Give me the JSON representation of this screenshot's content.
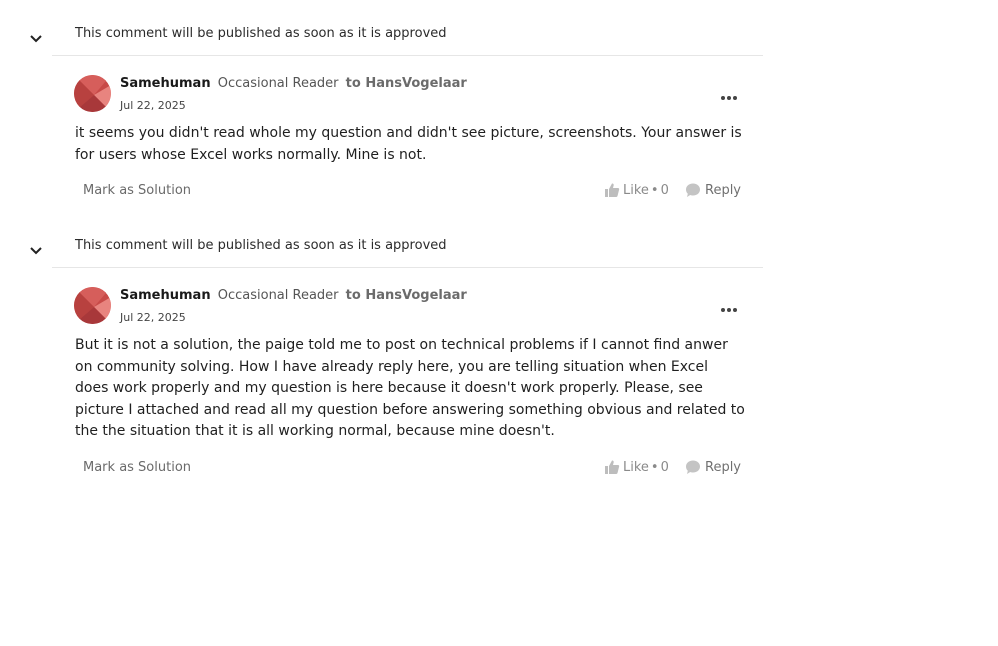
{
  "comments": [
    {
      "pending_note": "This comment will be published as soon as it is approved",
      "author": "Samehuman",
      "rank": "Occasional Reader",
      "to_label": "to HansVogelaar",
      "date": "Jul 22, 2025",
      "body": "it seems you didn't read whole my question and didn't see picture, screenshots. Your answer is for users whose Excel works normally. Mine is not.",
      "mark_solution_label": "Mark as Solution",
      "like_label": "Like",
      "like_separator": "•",
      "like_count": "0",
      "reply_label": "Reply"
    },
    {
      "pending_note": "This comment will be published as soon as it is approved",
      "author": "Samehuman",
      "rank": "Occasional Reader",
      "to_label": "to HansVogelaar",
      "date": "Jul 22, 2025",
      "body": "But it is not a solution, the paige told me to post on technical problems if I cannot find anwer on community solving. How I have already reply here, you are telling situation when Excel does work properly and my question is here because it doesn't work properly. Please, see picture I attached and read all my question before answering something obvious and related to the the situation that it is all working normal, because mine doesn't.",
      "mark_solution_label": "Mark as Solution",
      "like_label": "Like",
      "like_separator": "•",
      "like_count": "0",
      "reply_label": "Reply"
    }
  ],
  "icons": {
    "collapse": "chevron-down-icon",
    "more": "more-options-icon",
    "like": "thumbs-up-icon",
    "reply": "speech-bubble-icon"
  },
  "colors": {
    "avatar_dark": "#b7403f",
    "avatar_light": "#e0706c",
    "divider": "#e6e6e6"
  }
}
